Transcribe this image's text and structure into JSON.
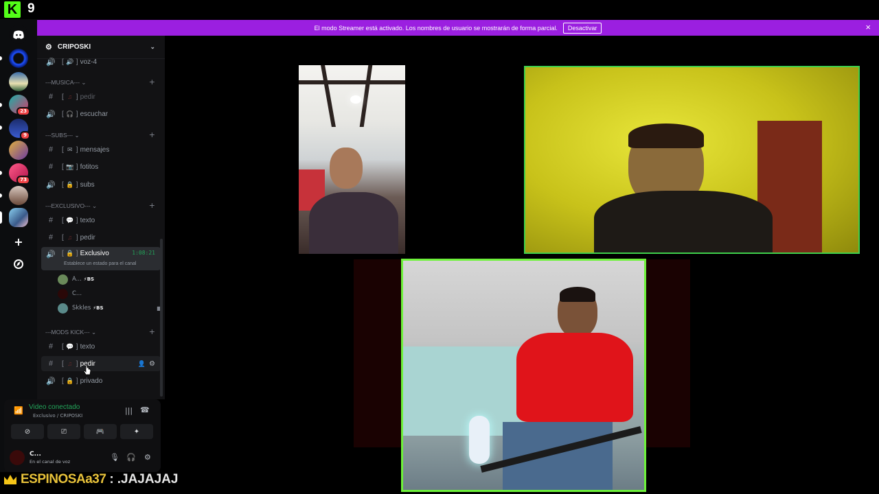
{
  "topbar": {
    "kick_count": "9",
    "kick_logo_letter": "K"
  },
  "banner": {
    "text": "El modo Streamer está activado. Los nombres de usuario se mostrarán de forma parcial.",
    "button": "Desactivar",
    "close": "×"
  },
  "servers": {
    "badges": [
      "23",
      "9",
      "73"
    ]
  },
  "guild": {
    "name": "CRIPOSKI",
    "chevron": "⌄"
  },
  "categories": {
    "musica": "---MUSICA---",
    "subs": "---SUBS---",
    "exclusivo": "---EXCLUSIVO---",
    "mods": "---MODS KICK---"
  },
  "channels": {
    "voz4": "voz-4",
    "pedir1": "pedir",
    "escuchar": "escuchar",
    "mensajes": "mensajes",
    "fotitos": "fotitos",
    "subs": "subs",
    "texto1": "texto",
    "pedir2": "pedir",
    "exclusivo": "Exclusivo",
    "texto2": "texto",
    "pedir3": "pedir",
    "privado": "privado"
  },
  "voice_channel": {
    "timer": "1:08:21",
    "status_hint": "Establece un estado para el canal",
    "users": [
      {
        "name": "A...",
        "tag": "⚡BS"
      },
      {
        "name": "C...",
        "tag": ""
      },
      {
        "name": "Skkles",
        "tag": "⚡BS"
      }
    ]
  },
  "voice_panel": {
    "title": "Video conectado",
    "subtitle": "Exclusivo / CRIPOSKI"
  },
  "user": {
    "name": "C...",
    "status": "En el canal de voz"
  },
  "chat": {
    "username": "ESPINOSAa37",
    "separator": ":",
    "message": ".JAJAJAJ"
  },
  "colors": {
    "banner": "#9b1fe0",
    "kick_green": "#53fc18",
    "speaking_border": "#3fd14c",
    "chat_username": "#e8c23a"
  }
}
